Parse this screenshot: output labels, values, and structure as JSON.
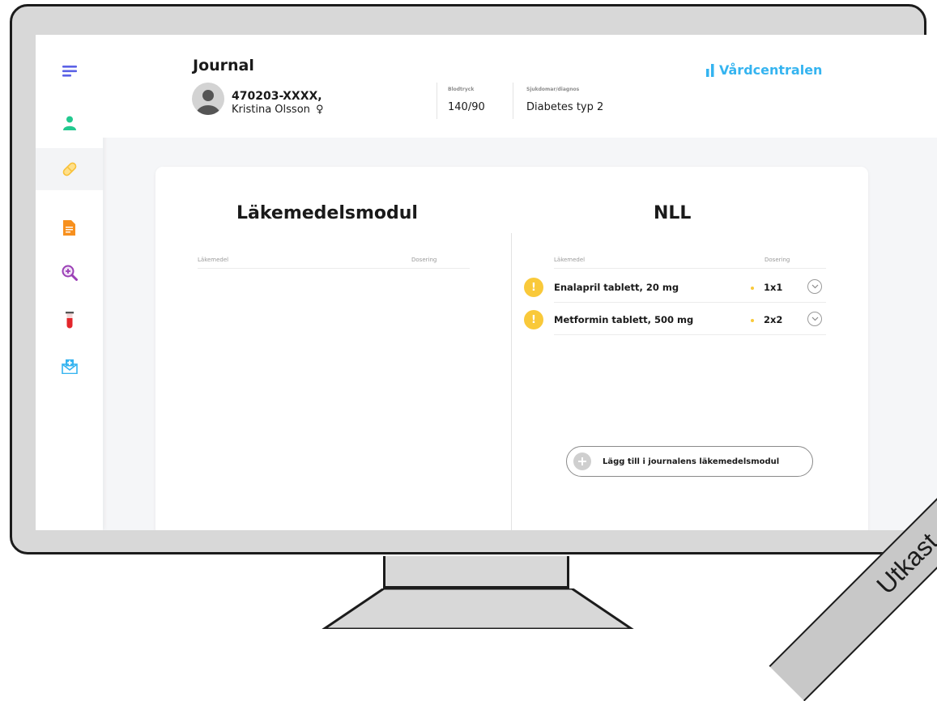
{
  "header": {
    "title": "Journal",
    "patient": {
      "id": "470203-XXXX,",
      "name": "Kristina Olsson",
      "gender_symbol": "♀"
    },
    "stats": [
      {
        "label": "Blodtryck",
        "value": "140/90"
      },
      {
        "label": "Sjukdomar/diagnos",
        "value": "Diabetes typ 2"
      }
    ],
    "brand": "Vårdcentralen"
  },
  "sidebar": {
    "items": [
      {
        "icon": "menu-icon",
        "color": "#5b62e6"
      },
      {
        "icon": "person-icon",
        "color": "#22c98f"
      },
      {
        "icon": "pill-icon",
        "color": "#f8c13a",
        "active": true
      },
      {
        "icon": "document-icon",
        "color": "#f7901e"
      },
      {
        "icon": "zoom-in-icon",
        "color": "#9b3fb6"
      },
      {
        "icon": "test-tube-icon",
        "color": "#e3262b"
      },
      {
        "icon": "mail-cross-icon",
        "color": "#35b4f0"
      }
    ]
  },
  "left_panel": {
    "title": "Läkemedelsmodul",
    "columns": [
      "Läkemedel",
      "Dosering"
    ],
    "rows": []
  },
  "right_panel": {
    "title": "NLL",
    "columns": [
      "Läkemedel",
      "Dosering"
    ],
    "rows": [
      {
        "warning": "!",
        "name": "Enalapril tablett, 20 mg",
        "dose": "1x1"
      },
      {
        "warning": "!",
        "name": "Metformin tablett, 500 mg",
        "dose": "2x2"
      }
    ],
    "add_button": "Lägg till i journalens läkemedelsmodul"
  },
  "watermark": "Utkast",
  "colors": {
    "brand": "#35b4f0",
    "warning": "#f9c93a"
  }
}
